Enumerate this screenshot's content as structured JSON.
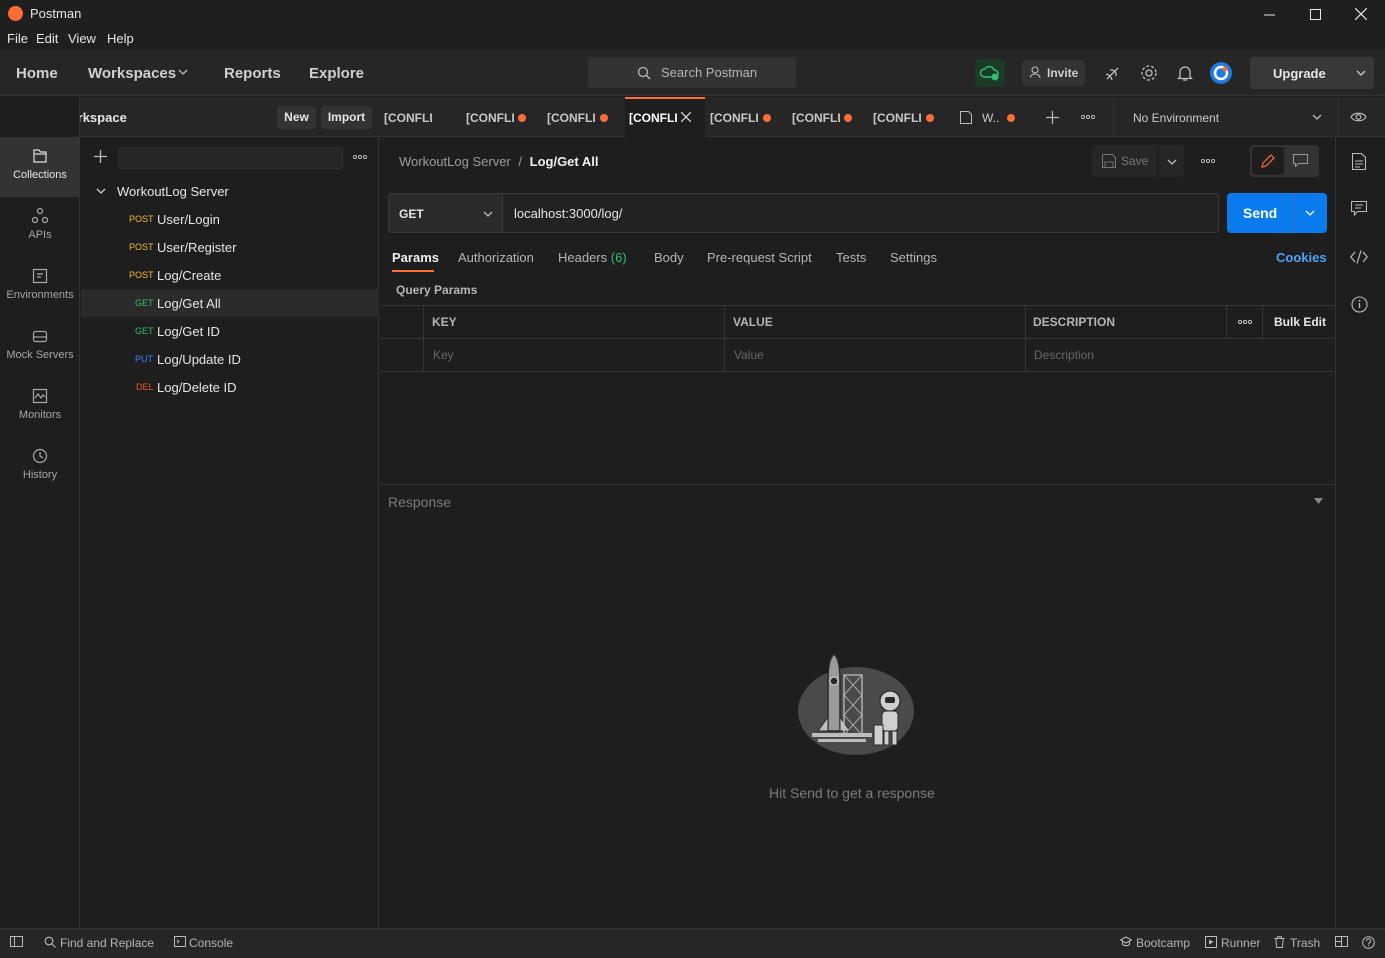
{
  "window": {
    "title": "Postman"
  },
  "menu": [
    "File",
    "Edit",
    "View",
    "Help"
  ],
  "header": {
    "nav": [
      "Home",
      "Workspaces",
      "Reports",
      "Explore"
    ],
    "search_placeholder": "Search Postman",
    "invite_label": "Invite",
    "upgrade_label": "Upgrade"
  },
  "workspace": {
    "name": "My Workspace",
    "new_label": "New",
    "import_label": "Import"
  },
  "rail": [
    {
      "label": "Collections",
      "icon": "collections-icon"
    },
    {
      "label": "APIs",
      "icon": "apis-icon"
    },
    {
      "label": "Environments",
      "icon": "environments-icon"
    },
    {
      "label": "Mock Servers",
      "icon": "mock-servers-icon"
    },
    {
      "label": "Monitors",
      "icon": "monitors-icon"
    },
    {
      "label": "History",
      "icon": "history-icon"
    }
  ],
  "collection": {
    "name": "WorkoutLog Server",
    "requests": [
      {
        "method": "POST",
        "name": "User/Login",
        "color": "#f8b633"
      },
      {
        "method": "POST",
        "name": "User/Register",
        "color": "#f8b633"
      },
      {
        "method": "POST",
        "name": "Log/Create",
        "color": "#f8b633"
      },
      {
        "method": "GET",
        "name": "Log/Get All",
        "color": "#2fbf71"
      },
      {
        "method": "GET",
        "name": "Log/Get ID",
        "color": "#2fbf71"
      },
      {
        "method": "PUT",
        "name": "Log/Update ID",
        "color": "#3a86ff"
      },
      {
        "method": "DEL",
        "name": "Log/Delete ID",
        "color": "#ef5b25"
      }
    ]
  },
  "tabs": [
    {
      "label": "[CONFLI",
      "dirty": false
    },
    {
      "label": "[CONFLI",
      "dirty": true
    },
    {
      "label": "[CONFLI",
      "dirty": true
    },
    {
      "label": "[CONFLI",
      "dirty": false,
      "active": true
    },
    {
      "label": "[CONFLI",
      "dirty": true
    },
    {
      "label": "[CONFLI",
      "dirty": true
    },
    {
      "label": "[CONFLI",
      "dirty": true
    },
    {
      "label": "W..",
      "dirty": true
    }
  ],
  "environment": {
    "selected": "No Environment"
  },
  "request": {
    "breadcrumb_parent": "WorkoutLog Server",
    "breadcrumb_separator": "/",
    "breadcrumb_current": "Log/Get All",
    "save_label": "Save",
    "method": "GET",
    "url": "localhost:3000/log/",
    "send_label": "Send",
    "tabs": [
      "Params",
      "Authorization",
      "Headers",
      "Body",
      "Pre-request Script",
      "Tests",
      "Settings"
    ],
    "headers_count": "(6)",
    "cookies_label": "Cookies",
    "query_params_label": "Query Params",
    "table": {
      "headers": [
        "KEY",
        "VALUE",
        "DESCRIPTION"
      ],
      "bulk_edit_label": "Bulk Edit",
      "placeholders": [
        "Key",
        "Value",
        "Description"
      ]
    }
  },
  "response": {
    "label": "Response",
    "empty_text": "Hit Send to get a response"
  },
  "statusbar": {
    "find_replace": "Find and Replace",
    "console": "Console",
    "bootcamp": "Bootcamp",
    "runner": "Runner",
    "trash": "Trash"
  },
  "colors": {
    "accent": "#ff6c37",
    "send": "#097bed",
    "link": "#4ea3f5"
  }
}
